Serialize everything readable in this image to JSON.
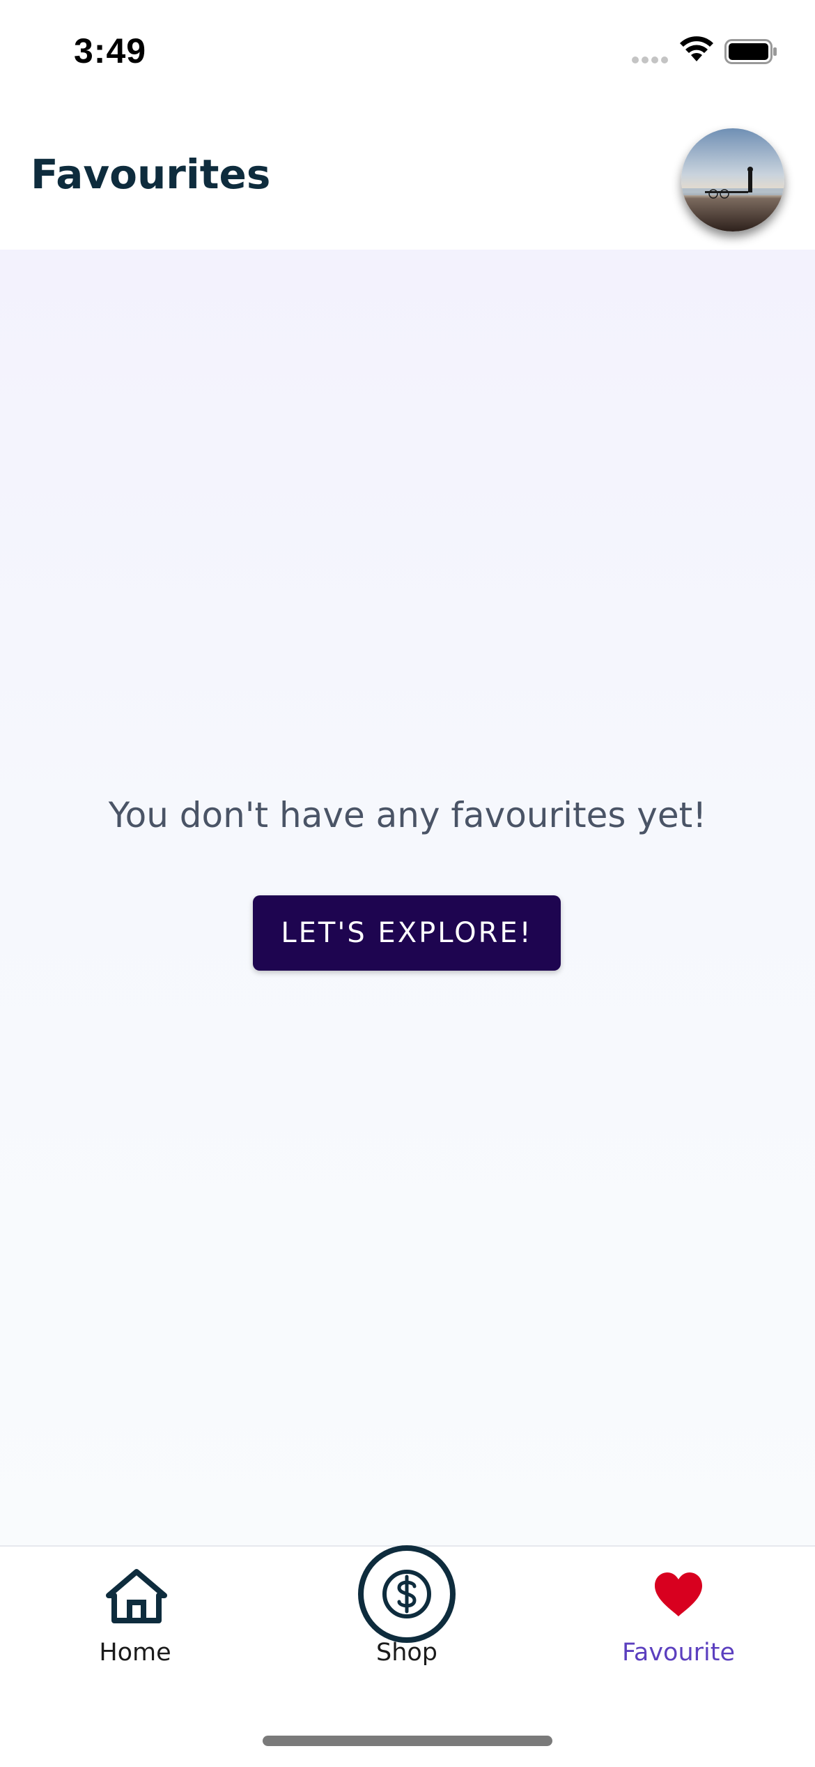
{
  "status_bar": {
    "time": "3:49"
  },
  "header": {
    "title": "Favourites"
  },
  "main": {
    "empty_message": "You don't have any favourites yet!",
    "explore_button_label": "LET'S EXPLORE!"
  },
  "tab_bar": {
    "items": [
      {
        "label": "Home",
        "icon": "home-icon"
      },
      {
        "label": "Shop",
        "icon": "dollar-icon"
      },
      {
        "label": "Favourite",
        "icon": "heart-icon",
        "active": true
      }
    ]
  },
  "colors": {
    "title": "#0e2c3d",
    "button_bg": "#1e0550",
    "active_tab": "#5b3fbf",
    "heart": "#d8001f"
  }
}
